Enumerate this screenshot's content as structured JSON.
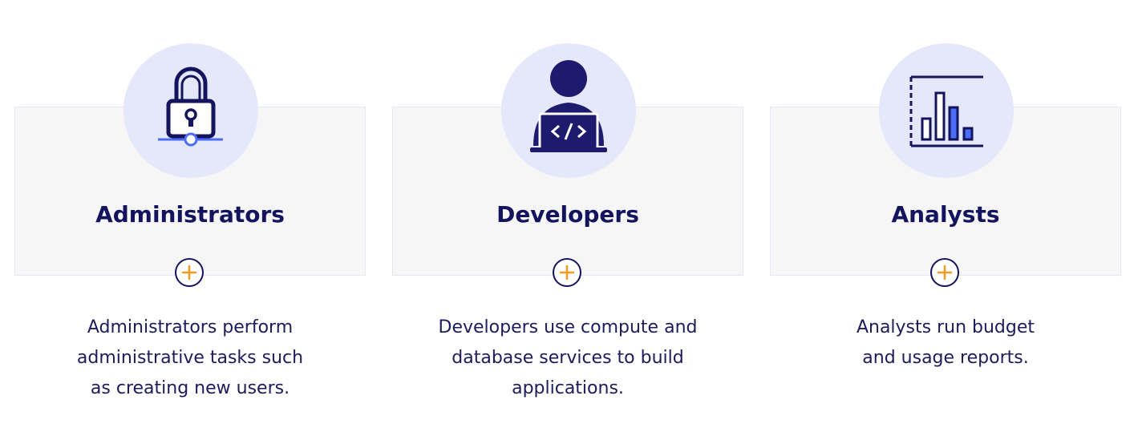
{
  "cards": [
    {
      "title": "Administrators",
      "icon": "padlock-network-icon",
      "description": "Administrators perform\nadministrative tasks such\nas creating new users."
    },
    {
      "title": "Developers",
      "icon": "developer-laptop-code-icon",
      "description": "Developers use compute and\ndatabase services to build\napplications."
    },
    {
      "title": "Analysts",
      "icon": "bar-chart-icon",
      "description": "Analysts run budget\nand usage reports."
    }
  ],
  "colors": {
    "navy": "#14135e",
    "accent_blue": "#4a6cf7",
    "accent_orange": "#f59a23",
    "icon_circle_bg": "#e5e8fb",
    "card_bg": "#f6f6f7"
  }
}
